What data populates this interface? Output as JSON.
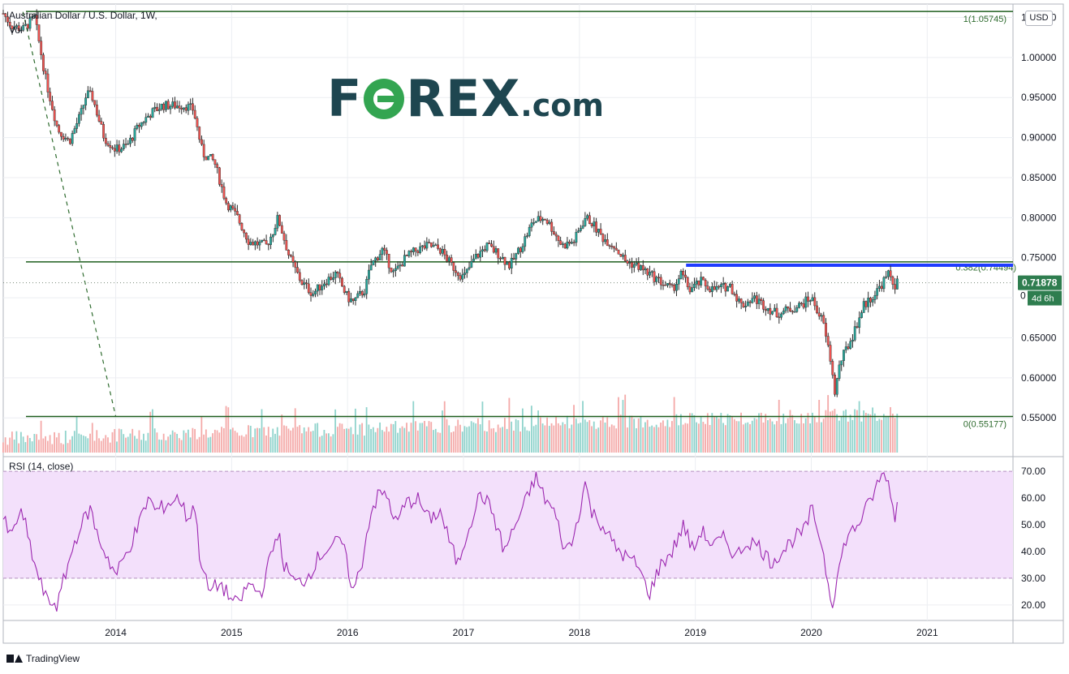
{
  "header": {
    "title": "Australian Dollar / U.S. Dollar, 1W,",
    "volume_label": "Vol",
    "currency": "USD"
  },
  "logo": {
    "brand_left": "F",
    "brand_right": "REX",
    "suffix": ".com"
  },
  "footer": {
    "brand": "TradingView"
  },
  "colors": {
    "up": "#26a69a",
    "down": "#ef5350",
    "level": "#1e5e1e",
    "resistance": "#1f3bff",
    "rsi": "#9c27b0",
    "rsi_band": "#f3e0fb",
    "price_badge": "#2e7d4f"
  },
  "chart_data": [
    {
      "type": "candlestick",
      "title": "Australian Dollar / U.S. Dollar, 1W,",
      "x_ticks": [
        "2014",
        "2015",
        "2016",
        "2017",
        "2018",
        "2019",
        "2020",
        "2021"
      ],
      "x_tick_values": [
        2014,
        2015,
        2016,
        2017,
        2018,
        2019,
        2020,
        2021
      ],
      "xlim": [
        2013.03,
        2021.74
      ],
      "y_ticks": [
        "1.05000",
        "1.00000",
        "0.95000",
        "0.90000",
        "0.85000",
        "0.80000",
        "0.75000",
        "0.65000",
        "0.60000",
        "0.55000"
      ],
      "y_tick_values": [
        1.05,
        1.0,
        0.95,
        0.9,
        0.85,
        0.8,
        0.75,
        0.65,
        0.6,
        0.55
      ],
      "ylim": [
        0.5067,
        1.0667
      ],
      "close_path": [
        [
          2013.03,
          1.055
        ],
        [
          2013.1,
          1.04
        ],
        [
          2013.2,
          1.035
        ],
        [
          2013.3,
          1.05
        ],
        [
          2013.4,
          0.97
        ],
        [
          2013.5,
          0.91
        ],
        [
          2013.6,
          0.895
        ],
        [
          2013.7,
          0.93
        ],
        [
          2013.75,
          0.955
        ],
        [
          2013.8,
          0.95
        ],
        [
          2013.9,
          0.9
        ],
        [
          2014.0,
          0.885
        ],
        [
          2014.1,
          0.89
        ],
        [
          2014.2,
          0.915
        ],
        [
          2014.3,
          0.93
        ],
        [
          2014.4,
          0.94
        ],
        [
          2014.5,
          0.94
        ],
        [
          2014.6,
          0.94
        ],
        [
          2014.67,
          0.935
        ],
        [
          2014.75,
          0.88
        ],
        [
          2014.85,
          0.87
        ],
        [
          2014.95,
          0.82
        ],
        [
          2015.05,
          0.8
        ],
        [
          2015.15,
          0.77
        ],
        [
          2015.3,
          0.765
        ],
        [
          2015.35,
          0.78
        ],
        [
          2015.4,
          0.8
        ],
        [
          2015.5,
          0.75
        ],
        [
          2015.6,
          0.72
        ],
        [
          2015.7,
          0.705
        ],
        [
          2015.8,
          0.72
        ],
        [
          2015.9,
          0.73
        ],
        [
          2016.0,
          0.7
        ],
        [
          2016.05,
          0.695
        ],
        [
          2016.15,
          0.71
        ],
        [
          2016.2,
          0.74
        ],
        [
          2016.3,
          0.76
        ],
        [
          2016.4,
          0.73
        ],
        [
          2016.5,
          0.75
        ],
        [
          2016.6,
          0.76
        ],
        [
          2016.7,
          0.765
        ],
        [
          2016.8,
          0.76
        ],
        [
          2016.9,
          0.74
        ],
        [
          2017.0,
          0.725
        ],
        [
          2017.1,
          0.75
        ],
        [
          2017.2,
          0.765
        ],
        [
          2017.3,
          0.755
        ],
        [
          2017.4,
          0.74
        ],
        [
          2017.5,
          0.765
        ],
        [
          2017.6,
          0.795
        ],
        [
          2017.7,
          0.8
        ],
        [
          2017.75,
          0.79
        ],
        [
          2017.85,
          0.765
        ],
        [
          2017.95,
          0.77
        ],
        [
          2018.05,
          0.8
        ],
        [
          2018.1,
          0.795
        ],
        [
          2018.2,
          0.775
        ],
        [
          2018.3,
          0.765
        ],
        [
          2018.4,
          0.745
        ],
        [
          2018.5,
          0.74
        ],
        [
          2018.6,
          0.73
        ],
        [
          2018.7,
          0.72
        ],
        [
          2018.8,
          0.71
        ],
        [
          2018.88,
          0.73
        ],
        [
          2018.95,
          0.71
        ],
        [
          2019.05,
          0.72
        ],
        [
          2019.15,
          0.71
        ],
        [
          2019.3,
          0.715
        ],
        [
          2019.4,
          0.69
        ],
        [
          2019.5,
          0.7
        ],
        [
          2019.6,
          0.69
        ],
        [
          2019.7,
          0.68
        ],
        [
          2019.8,
          0.685
        ],
        [
          2019.9,
          0.69
        ],
        [
          2020.0,
          0.7
        ],
        [
          2020.1,
          0.67
        ],
        [
          2020.17,
          0.62
        ],
        [
          2020.2,
          0.58
        ],
        [
          2020.25,
          0.62
        ],
        [
          2020.35,
          0.65
        ],
        [
          2020.45,
          0.69
        ],
        [
          2020.55,
          0.705
        ],
        [
          2020.62,
          0.72
        ],
        [
          2020.67,
          0.73
        ],
        [
          2020.72,
          0.715
        ],
        [
          2020.74,
          0.719
        ]
      ],
      "volume_label": "Vol",
      "horizontal_levels": [
        {
          "label": "1(1.05745)",
          "value": 1.05745
        },
        {
          "label": "0(0.55177)",
          "value": 0.55177
        },
        {
          "label": "",
          "value": 0.7448
        }
      ],
      "fib_label": "0.382(0.74494)",
      "fib_value": 0.74494,
      "resistance_line": {
        "value": 0.7406,
        "x_start": 2018.92,
        "x_end": 2021.74
      },
      "trend_line": {
        "from": [
          2013.2,
          1.057
        ],
        "to": [
          2014.0,
          0.552
        ]
      },
      "last_price": "0.71878",
      "last_price_value": 0.71878,
      "countdown": "4d 6h",
      "partial_label": "0"
    },
    {
      "type": "line",
      "title": "RSI (14, close)",
      "y_ticks": [
        "70.00",
        "60.00",
        "50.00",
        "40.00",
        "30.00",
        "20.00"
      ],
      "y_tick_values": [
        70,
        60,
        50,
        40,
        30,
        20
      ],
      "ylim": [
        14.2,
        75.5
      ],
      "band": [
        30,
        70
      ],
      "points": [
        [
          2013.03,
          52
        ],
        [
          2013.1,
          45
        ],
        [
          2013.17,
          55
        ],
        [
          2013.22,
          50
        ],
        [
          2013.3,
          35
        ],
        [
          2013.4,
          22
        ],
        [
          2013.5,
          20
        ],
        [
          2013.58,
          34
        ],
        [
          2013.68,
          48
        ],
        [
          2013.78,
          56
        ],
        [
          2013.85,
          45
        ],
        [
          2013.95,
          36
        ],
        [
          2014.0,
          31
        ],
        [
          2014.1,
          40
        ],
        [
          2014.2,
          50
        ],
        [
          2014.28,
          60
        ],
        [
          2014.35,
          55
        ],
        [
          2014.45,
          58
        ],
        [
          2014.55,
          60
        ],
        [
          2014.62,
          52
        ],
        [
          2014.68,
          58
        ],
        [
          2014.72,
          40
        ],
        [
          2014.8,
          25
        ],
        [
          2014.9,
          28
        ],
        [
          2015.0,
          22
        ],
        [
          2015.05,
          20
        ],
        [
          2015.15,
          28
        ],
        [
          2015.25,
          24
        ],
        [
          2015.35,
          40
        ],
        [
          2015.4,
          48
        ],
        [
          2015.45,
          35
        ],
        [
          2015.55,
          28
        ],
        [
          2015.65,
          30
        ],
        [
          2015.75,
          38
        ],
        [
          2015.85,
          42
        ],
        [
          2015.95,
          44
        ],
        [
          2016.05,
          25
        ],
        [
          2016.12,
          35
        ],
        [
          2016.2,
          55
        ],
        [
          2016.28,
          62
        ],
        [
          2016.35,
          60
        ],
        [
          2016.42,
          50
        ],
        [
          2016.5,
          58
        ],
        [
          2016.6,
          60
        ],
        [
          2016.7,
          52
        ],
        [
          2016.8,
          55
        ],
        [
          2016.87,
          45
        ],
        [
          2016.95,
          35
        ],
        [
          2017.05,
          50
        ],
        [
          2017.15,
          62
        ],
        [
          2017.25,
          55
        ],
        [
          2017.35,
          40
        ],
        [
          2017.45,
          50
        ],
        [
          2017.55,
          60
        ],
        [
          2017.62,
          68
        ],
        [
          2017.7,
          60
        ],
        [
          2017.78,
          55
        ],
        [
          2017.88,
          40
        ],
        [
          2017.95,
          45
        ],
        [
          2018.05,
          66
        ],
        [
          2018.1,
          55
        ],
        [
          2018.2,
          50
        ],
        [
          2018.3,
          42
        ],
        [
          2018.4,
          38
        ],
        [
          2018.5,
          35
        ],
        [
          2018.6,
          24
        ],
        [
          2018.7,
          35
        ],
        [
          2018.8,
          40
        ],
        [
          2018.9,
          50
        ],
        [
          2018.98,
          40
        ],
        [
          2019.05,
          48
        ],
        [
          2019.15,
          42
        ],
        [
          2019.25,
          45
        ],
        [
          2019.35,
          38
        ],
        [
          2019.45,
          44
        ],
        [
          2019.55,
          42
        ],
        [
          2019.65,
          36
        ],
        [
          2019.75,
          40
        ],
        [
          2019.85,
          45
        ],
        [
          2019.95,
          48
        ],
        [
          2020.0,
          56
        ],
        [
          2020.08,
          45
        ],
        [
          2020.12,
          35
        ],
        [
          2020.18,
          20
        ],
        [
          2020.22,
          30
        ],
        [
          2020.3,
          45
        ],
        [
          2020.4,
          50
        ],
        [
          2020.5,
          58
        ],
        [
          2020.58,
          66
        ],
        [
          2020.64,
          70
        ],
        [
          2020.68,
          62
        ],
        [
          2020.72,
          53
        ],
        [
          2020.74,
          58
        ]
      ]
    }
  ]
}
